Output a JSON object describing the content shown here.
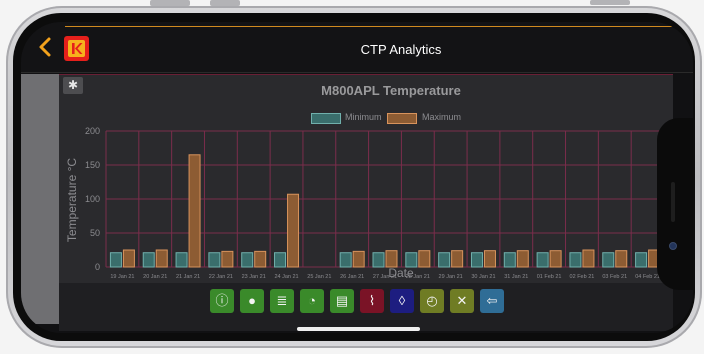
{
  "header": {
    "title": "CTP Analytics",
    "back_icon": "back-chevron-icon",
    "logo_icon": "kodak-logo-icon",
    "accent_color": "#d08a1f"
  },
  "settings_button": {
    "icon": "gear-icon",
    "glyph": "✱"
  },
  "chart_data": {
    "type": "bar",
    "title": "M800APL Temperature",
    "xlabel": "Date",
    "ylabel": "Temperature °C",
    "ylim": [
      0,
      200
    ],
    "yticks": [
      0,
      50,
      100,
      150,
      200
    ],
    "categories": [
      "19 Jan 21",
      "20 Jan 21",
      "21 Jan 21",
      "22 Jan 21",
      "23 Jan 21",
      "24 Jan 21",
      "25 Jan 21",
      "26 Jan 21",
      "27 Jan 21",
      "28 Jan 21",
      "29 Jan 21",
      "30 Jan 21",
      "31 Jan 21",
      "01 Feb 21",
      "02 Feb 21",
      "03 Feb 21",
      "04 Feb 21"
    ],
    "series": [
      {
        "name": "Minimum",
        "color": "#3a6e6c",
        "values": [
          21,
          21,
          21,
          21,
          21,
          21,
          0,
          21,
          21,
          21,
          21,
          21,
          21,
          21,
          21,
          21,
          21
        ]
      },
      {
        "name": "Maximum",
        "color": "#8d5c33",
        "values": [
          25,
          25,
          165,
          23,
          23,
          107,
          0,
          23,
          24,
          24,
          24,
          24,
          24,
          24,
          25,
          24,
          25
        ]
      }
    ],
    "grid": true,
    "legend_position": "top-center"
  },
  "toolbar": {
    "buttons": [
      {
        "name": "info-icon",
        "glyph": "ⓘ",
        "color": "#3a8a2a"
      },
      {
        "name": "circle-icon",
        "glyph": "●",
        "color": "#3a8a2a"
      },
      {
        "name": "list-icon",
        "glyph": "≣",
        "color": "#3a8a2a"
      },
      {
        "name": "pie-chart-icon",
        "glyph": "◔",
        "color": "#3a8a2a"
      },
      {
        "name": "counter-icon",
        "glyph": "▤",
        "color": "#3a8a2a"
      },
      {
        "name": "thermometer-icon",
        "glyph": "⌇",
        "color": "#7a1326"
      },
      {
        "name": "water-drop-icon",
        "glyph": "◊",
        "color": "#1d1d80"
      },
      {
        "name": "gauge-icon",
        "glyph": "◴",
        "color": "#6f7c24"
      },
      {
        "name": "tools-icon",
        "glyph": "✕",
        "color": "#6f7c24"
      },
      {
        "name": "back-arrow-icon",
        "glyph": "⇦",
        "color": "#2f6d96"
      }
    ]
  }
}
